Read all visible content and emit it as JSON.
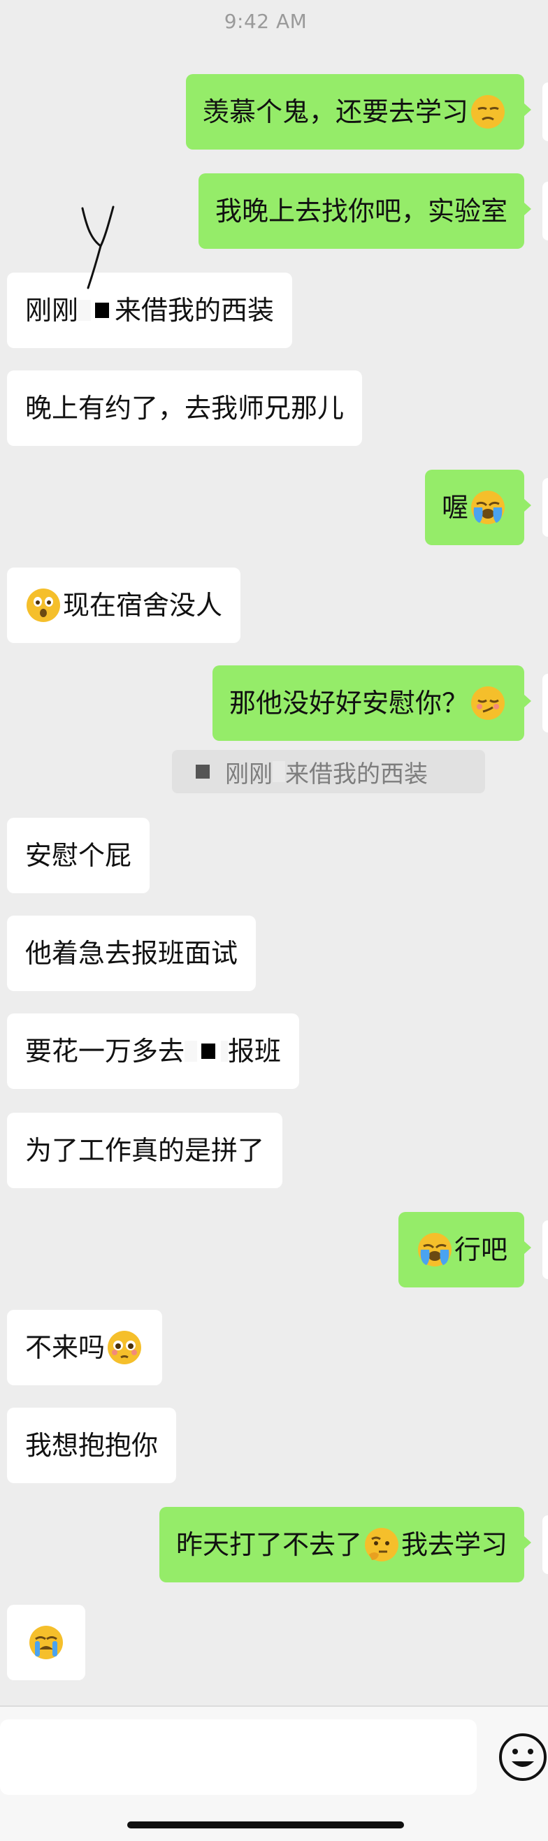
{
  "status": {
    "time": "9:42 AM"
  },
  "messages": [
    {
      "text_a": "羡慕个鬼，还要去学习",
      "emoji": "unamused-face-emoji"
    },
    {
      "text_a": "我晚上去找你吧，实验室"
    },
    {
      "text_a": "刚刚",
      "text_b": "来借我的西装",
      "has_censor": true
    },
    {
      "text_a": "晚上有约了，去我师兄那儿"
    },
    {
      "text_a": "喔",
      "emoji": "loudly-crying-emoji"
    },
    {
      "text_a": "现在宿舍没人",
      "emoji": "astonished-face-emoji"
    },
    {
      "text_a": "那他没好好安慰你？",
      "emoji": "smirking-face-emoji"
    },
    {
      "text_a": "安慰个屁"
    },
    {
      "text_a": "他着急去报班面试"
    },
    {
      "text_a": "要花一万多去",
      "text_b": "报班",
      "has_censor": true
    },
    {
      "text_a": "为了工作真的是拼了"
    },
    {
      "text_a": "行吧",
      "emoji": "loudly-crying-emoji"
    },
    {
      "text_a": "不来吗",
      "emoji": "pleading-face-emoji"
    },
    {
      "text_a": "我想抱抱你"
    },
    {
      "text_a": "昨天打了不去了",
      "text_b": "我去学习",
      "emoji": "thinking-face-emoji"
    },
    {
      "emoji": "loudly-crying-emoji"
    }
  ],
  "quoted_reply": {
    "text_a": "刚刚",
    "text_b": "来借我的西装"
  },
  "input": {
    "value": "",
    "emoji_button_icon": "smile-face-icon"
  },
  "colors": {
    "background": "#ededed",
    "outgoing_bubble": "#95ec69",
    "incoming_bubble": "#ffffff",
    "timestamp": "#9a9a9a"
  }
}
